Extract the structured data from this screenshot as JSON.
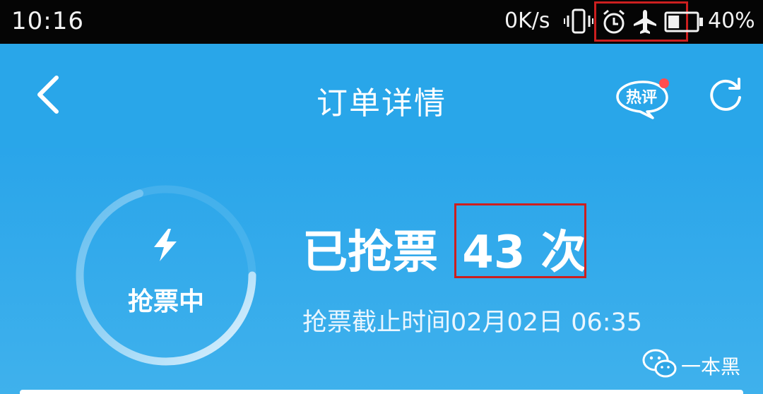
{
  "status_bar": {
    "time": "10:16",
    "network_speed": "0K/s",
    "battery_percent": "40%",
    "icons": [
      "vibrate-icon",
      "alarm-icon",
      "airplane-mode-icon",
      "battery-icon"
    ],
    "battery_level": 0.4
  },
  "title_bar": {
    "title": "订单详情",
    "hot_review_label": "热评",
    "icons": [
      "back-arrow-icon",
      "refresh-icon"
    ],
    "notification_dot_color": "#ff4d4f"
  },
  "order_status": {
    "ring_label": "抢票中",
    "grab_prefix": "已抢票",
    "grab_count": "43 次",
    "deadline_text": "抢票截止时间02月02日 06:35",
    "ring_progress": 0.7
  },
  "watermark": {
    "text": "一本黑",
    "icon": "wechat-icon"
  },
  "colors": {
    "accent": "#29a6e9",
    "highlight_box": "#cc1f1f"
  }
}
